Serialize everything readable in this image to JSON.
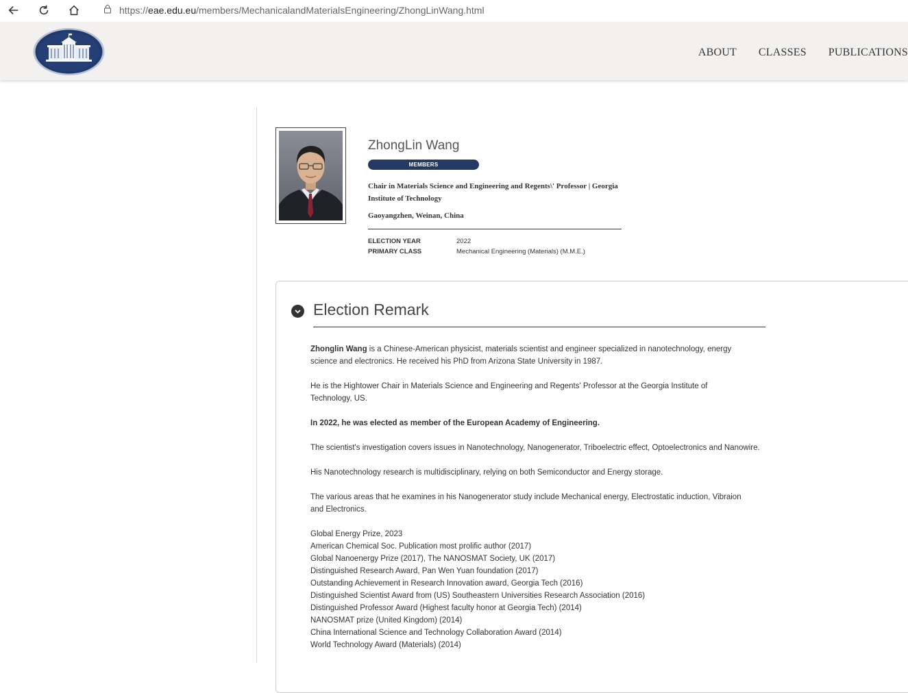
{
  "browser": {
    "url_prefix": "https://",
    "url_host": "eae.edu.eu",
    "url_path": "/members/MechanicalandMaterialsEngineering/ZhongLinWang.html"
  },
  "nav": {
    "items": [
      "ABOUT",
      "CLASSES",
      "PUBLICATIONS"
    ]
  },
  "profile": {
    "name": "ZhongLin Wang",
    "badge": "MEMBERS",
    "position": "Chair in Materials Science and Engineering and Regents\\' Professor  | Georgia Institute of Technology",
    "location": "Gaoyangzhen, Weinan, China",
    "election_year_label": "ELECTION YEAR",
    "election_year": "2022",
    "primary_class_label": "PRIMARY CLASS",
    "primary_class": "Mechanical Engineering (Materials) (M.M.E.)"
  },
  "remark": {
    "title": "Election Remark",
    "intro_bold": "Zhonglin Wang",
    "intro_rest": " is a Chinese-American physicist, materials scientist and engineer specialized in nanotechnology, energy science and electronics. He received his PhD from Arizona State University in 1987.",
    "p2": "He is the Hightower Chair in Materials Science and Engineering and Regents' Professor at the Georgia Institute of Technology, US.",
    "p3": "In 2022, he was elected as member of the European Academy of Engineering.",
    "p4": "The scientist's investigation covers issues in Nanotechnology, Nanogenerator, Triboelectric effect, Optoelectronics and Nanowire.",
    "p5": "His Nanotechnology research is multidisciplinary, relying on both Semiconductor and Energy storage.",
    "p6": "The various areas that he examines in his Nanogenerator study include Mechanical energy, Electrostatic induction, Vibraion and Electronics.",
    "awards": [
      "Global Energy Prize, 2023",
      "American Chemical Soc. Publication most prolific author (2017)",
      "Global Nanoenergy Prize (2017), The NANOSMAT Society, UK (2017)",
      "Distinguished Research Award, Pan Wen Yuan foundation (2017)",
      "Outstanding Achievement in Research Innovation award, Georgia Tech (2016)",
      "Distinguished Scientist Award from (US) Southeastern Universities Research Association (2016)",
      "Distinguished Professor Award (Highest faculty honor at Georgia Tech) (2014)",
      "NANOSMAT prize (United Kingdom) (2014)",
      "China International Science and Technology Collaboration Award (2014)",
      "World Technology Award (Materials) (2014)"
    ]
  },
  "colors": {
    "badge_bg": "#243a63",
    "header_bg": "#f2f1f0"
  }
}
